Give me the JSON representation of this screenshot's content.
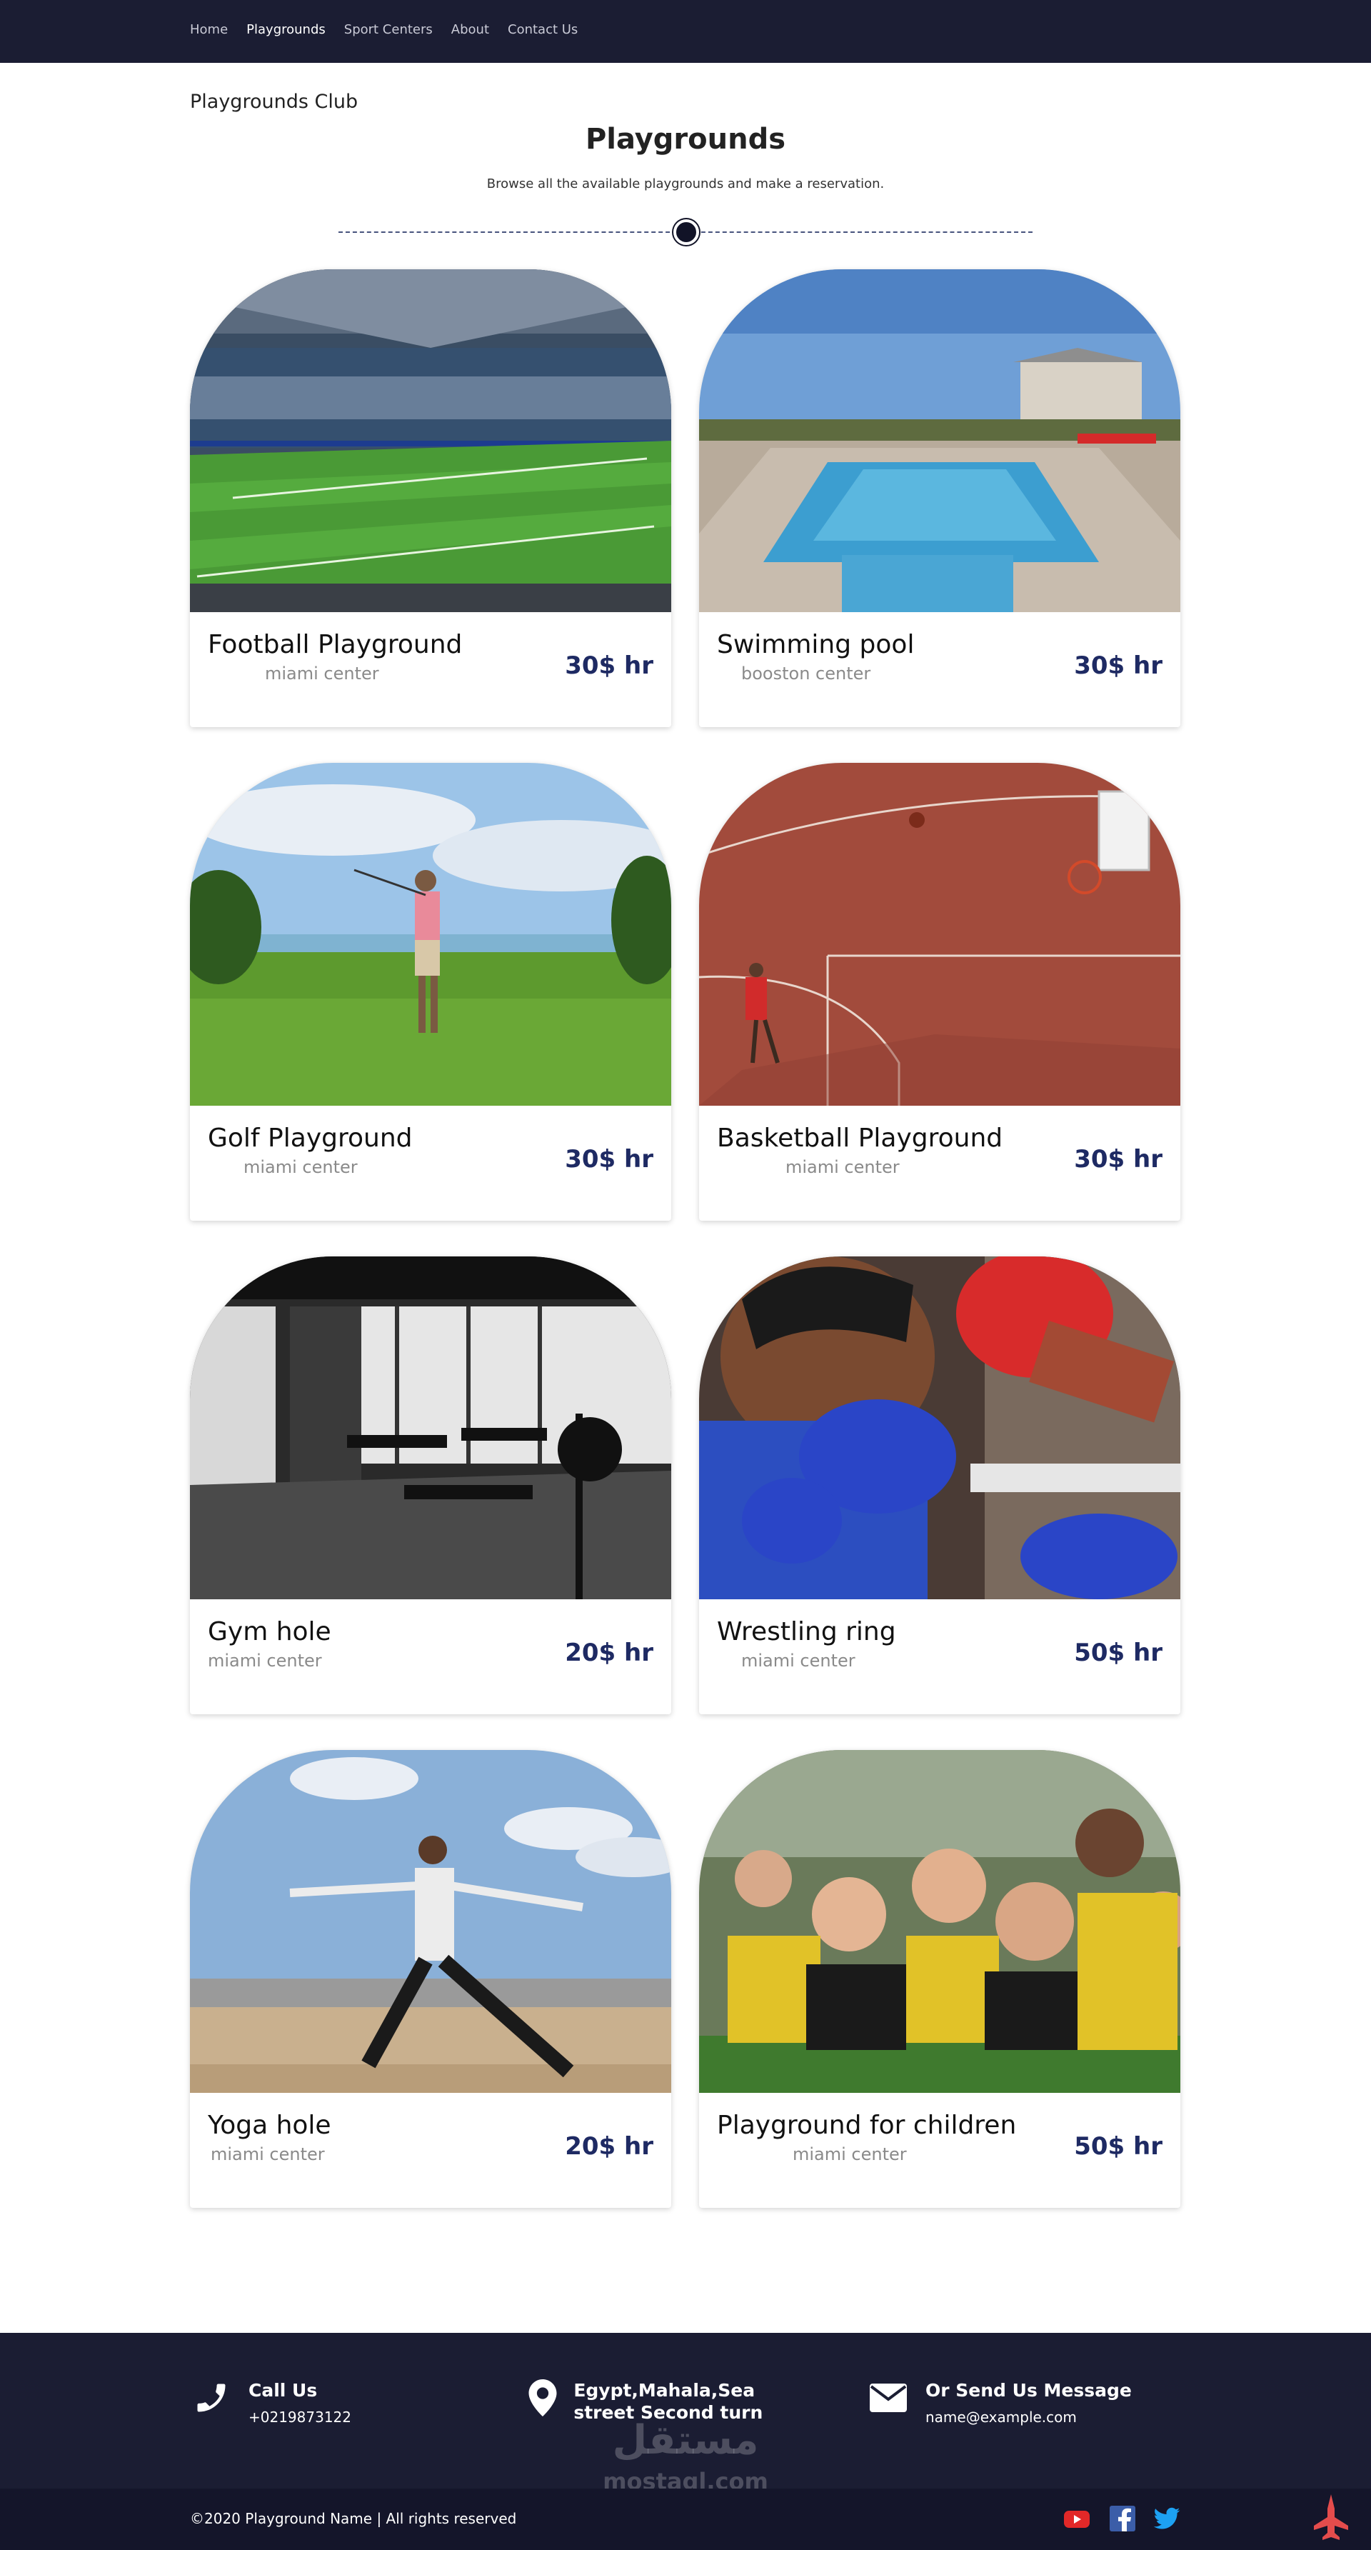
{
  "nav": {
    "links": [
      "Home",
      "Playgrounds",
      "Sport Centers",
      "About",
      "Contact Us"
    ],
    "active": "Playgrounds"
  },
  "brand": "Playgrounds Club",
  "header": {
    "title": "Playgrounds",
    "subtitle": "Browse all the available playgrounds and make a reservation."
  },
  "cards": [
    {
      "title": "Football Playground",
      "location": "miami center",
      "price": "30$ hr",
      "image": "stadium-photo"
    },
    {
      "title": "Swimming pool",
      "location": "booston center",
      "price": "30$ hr",
      "image": "pool-photo"
    },
    {
      "title": "Golf Playground",
      "location": "miami center",
      "price": "30$ hr",
      "image": "golf-photo"
    },
    {
      "title": "Basketball Playground",
      "location": "miami center",
      "price": "30$ hr",
      "image": "basketball-photo"
    },
    {
      "title": "Gym hole",
      "location": "miami center",
      "price": "20$ hr",
      "image": "gym-photo"
    },
    {
      "title": "Wrestling ring",
      "location": "miami center",
      "price": "50$ hr",
      "image": "boxing-photo"
    },
    {
      "title": "Yoga hole",
      "location": "miami center",
      "price": "20$ hr",
      "image": "yoga-photo"
    },
    {
      "title": "Playground for children",
      "location": "miami center",
      "price": "50$ hr",
      "image": "children-photo"
    }
  ],
  "footer": {
    "call": {
      "heading": "Call Us",
      "text": "+0219873122",
      "icon": "phone-icon"
    },
    "address": {
      "heading": "Egypt,Mahala,Sea street Second turn",
      "icon": "location-pin-icon"
    },
    "message": {
      "heading": "Or Send Us Message",
      "text": "name@example.com",
      "icon": "envelope-icon"
    },
    "copyright": "©2020 Playground Name | All rights reserved",
    "watermark": "مستقل\nmostaql.com"
  },
  "social": [
    "youtube-icon",
    "facebook-icon",
    "twitter-icon"
  ],
  "colors": {
    "nav": "#1b1d33",
    "price": "#1e2a63",
    "accent": "#e44c4c"
  }
}
